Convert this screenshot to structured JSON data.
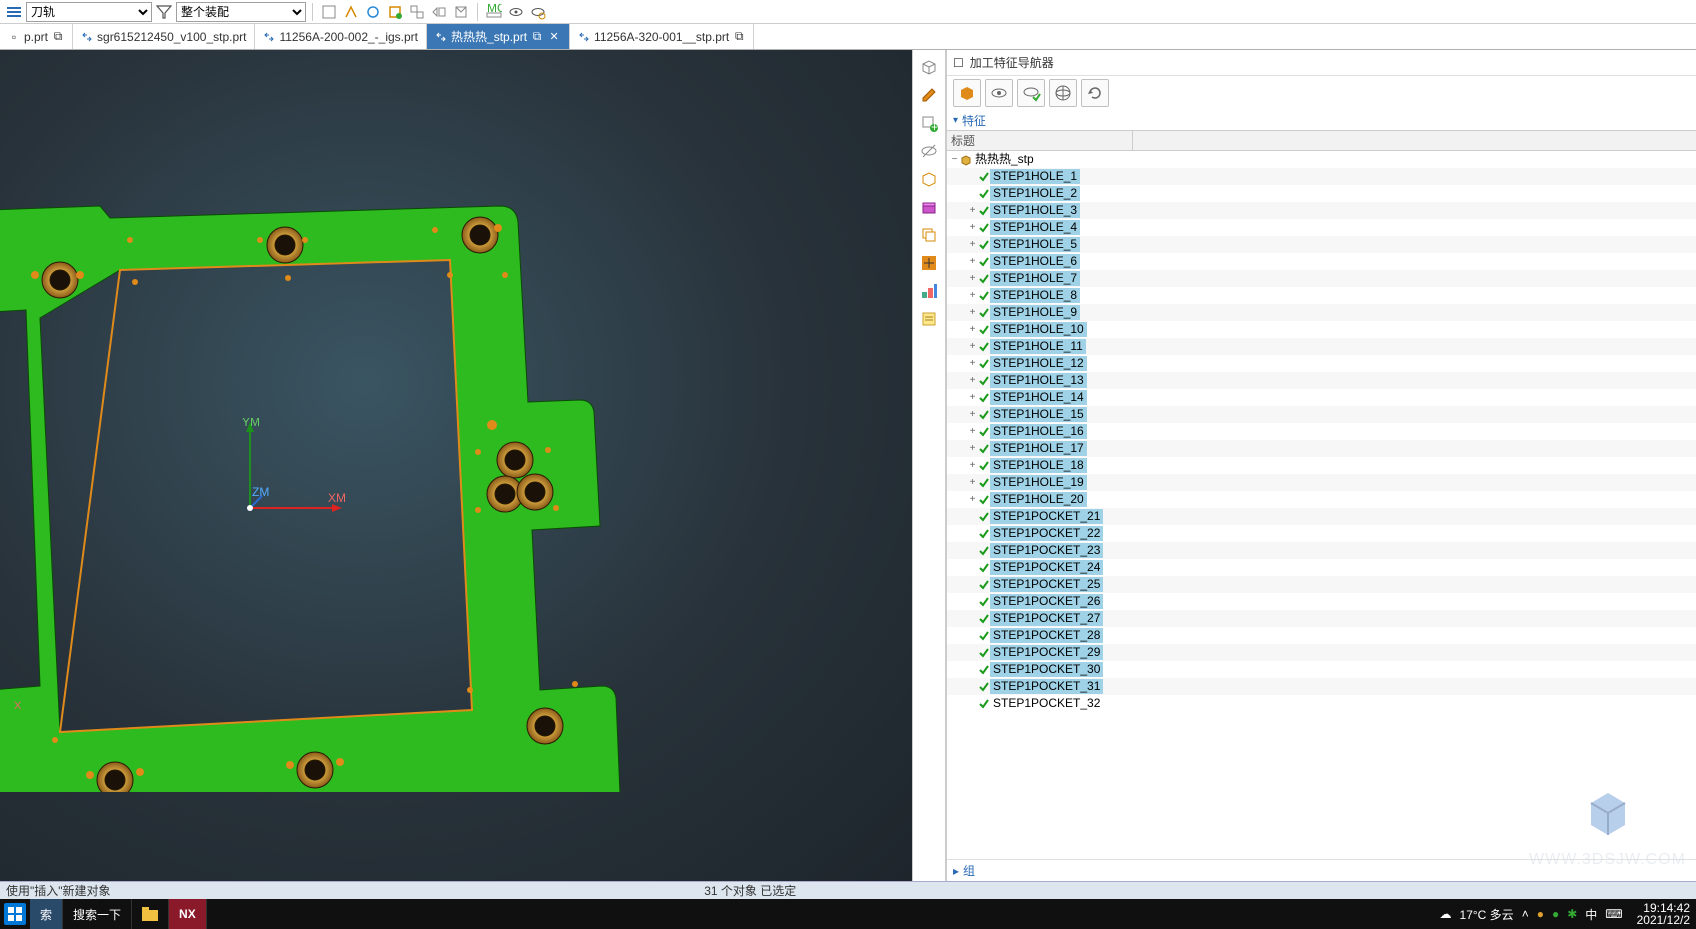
{
  "toolbar": {
    "dropdown1": "刀轨",
    "dropdown2": "整个装配"
  },
  "tabs": [
    {
      "label": "p.prt",
      "active": false,
      "ext": true
    },
    {
      "label": "sgr615212450_v100_stp.prt",
      "active": false,
      "ext": false
    },
    {
      "label": "11256A-200-002_-_igs.prt",
      "active": false,
      "ext": false
    },
    {
      "label": "热热热_stp.prt",
      "active": true,
      "ext": true,
      "close": true
    },
    {
      "label": "11256A-320-001__stp.prt",
      "active": false,
      "ext": true
    }
  ],
  "axis": {
    "x": "XM",
    "y": "YM",
    "z": "ZM",
    "xneg": "X"
  },
  "panel": {
    "title": "加工特征导航器",
    "section_features": "特征",
    "col_header": "标题",
    "root": "热热热_stp",
    "group": "组"
  },
  "tree": [
    {
      "label": "STEP1HOLE_1",
      "sel": true,
      "exp": ""
    },
    {
      "label": "STEP1HOLE_2",
      "sel": true,
      "exp": ""
    },
    {
      "label": "STEP1HOLE_3",
      "sel": true,
      "exp": "+"
    },
    {
      "label": "STEP1HOLE_4",
      "sel": true,
      "exp": "+"
    },
    {
      "label": "STEP1HOLE_5",
      "sel": true,
      "exp": "+"
    },
    {
      "label": "STEP1HOLE_6",
      "sel": true,
      "exp": "+"
    },
    {
      "label": "STEP1HOLE_7",
      "sel": true,
      "exp": "+"
    },
    {
      "label": "STEP1HOLE_8",
      "sel": true,
      "exp": "+"
    },
    {
      "label": "STEP1HOLE_9",
      "sel": true,
      "exp": "+"
    },
    {
      "label": "STEP1HOLE_10",
      "sel": true,
      "exp": "+"
    },
    {
      "label": "STEP1HOLE_11",
      "sel": true,
      "exp": "+"
    },
    {
      "label": "STEP1HOLE_12",
      "sel": true,
      "exp": "+"
    },
    {
      "label": "STEP1HOLE_13",
      "sel": true,
      "exp": "+"
    },
    {
      "label": "STEP1HOLE_14",
      "sel": true,
      "exp": "+"
    },
    {
      "label": "STEP1HOLE_15",
      "sel": true,
      "exp": "+"
    },
    {
      "label": "STEP1HOLE_16",
      "sel": true,
      "exp": "+"
    },
    {
      "label": "STEP1HOLE_17",
      "sel": true,
      "exp": "+"
    },
    {
      "label": "STEP1HOLE_18",
      "sel": true,
      "exp": "+"
    },
    {
      "label": "STEP1HOLE_19",
      "sel": true,
      "exp": "+"
    },
    {
      "label": "STEP1HOLE_20",
      "sel": true,
      "exp": "+"
    },
    {
      "label": "STEP1POCKET_21",
      "sel": true,
      "exp": ""
    },
    {
      "label": "STEP1POCKET_22",
      "sel": true,
      "exp": ""
    },
    {
      "label": "STEP1POCKET_23",
      "sel": true,
      "exp": ""
    },
    {
      "label": "STEP1POCKET_24",
      "sel": true,
      "exp": ""
    },
    {
      "label": "STEP1POCKET_25",
      "sel": true,
      "exp": ""
    },
    {
      "label": "STEP1POCKET_26",
      "sel": true,
      "exp": ""
    },
    {
      "label": "STEP1POCKET_27",
      "sel": true,
      "exp": ""
    },
    {
      "label": "STEP1POCKET_28",
      "sel": true,
      "exp": ""
    },
    {
      "label": "STEP1POCKET_29",
      "sel": true,
      "exp": ""
    },
    {
      "label": "STEP1POCKET_30",
      "sel": true,
      "exp": ""
    },
    {
      "label": "STEP1POCKET_31",
      "sel": true,
      "exp": ""
    },
    {
      "label": "STEP1POCKET_32",
      "sel": false,
      "exp": ""
    }
  ],
  "status": {
    "left": "使用\"插入\"新建对象",
    "center": "31 个对象 已选定"
  },
  "taskbar": {
    "search_label": "索",
    "search_full": "搜索一下",
    "nx": "NX",
    "weather": "17°C 多云",
    "ime": "中",
    "time": "19:14:42",
    "date": "2021/12/2"
  },
  "watermark": "WWW.3DSJW.COM"
}
